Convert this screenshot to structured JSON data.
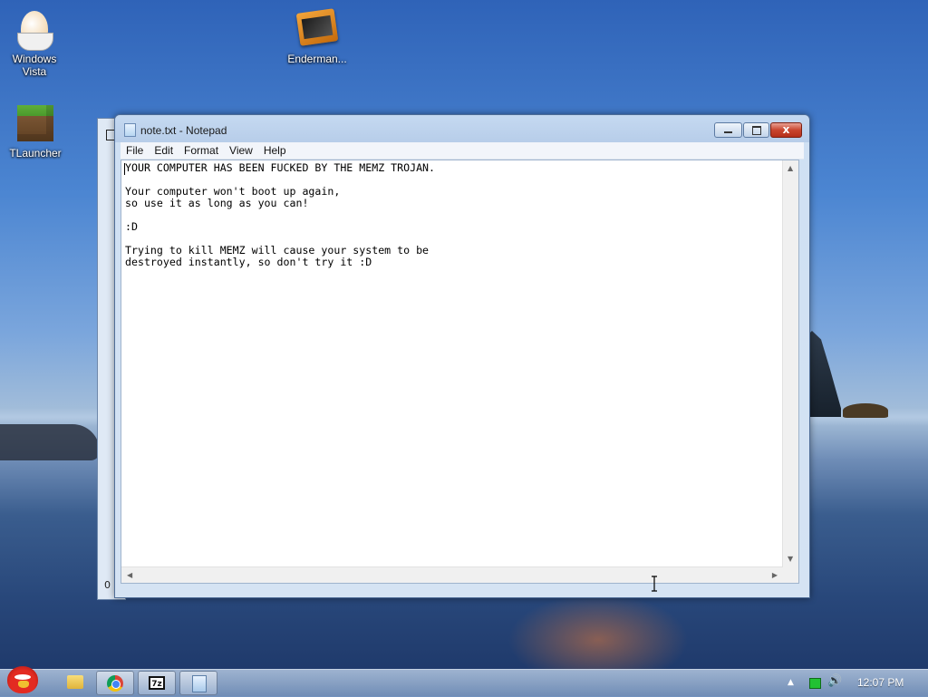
{
  "desktop": {
    "icons": [
      {
        "label": "Windows Vista"
      },
      {
        "label": "Enderman..."
      },
      {
        "label": "TLauncher"
      }
    ]
  },
  "background_window": {
    "status_digit": "0"
  },
  "notepad": {
    "title": "note.txt - Notepad",
    "menu": [
      "File",
      "Edit",
      "Format",
      "View",
      "Help"
    ],
    "content": "YOUR COMPUTER HAS BEEN FUCKED BY THE MEMZ TROJAN.\n\nYour computer won't boot up again,\nso use it as long as you can!\n\n:D\n\nTrying to kill MEMZ will cause your system to be\ndestroyed instantly, so don't try it :D",
    "close_glyph": "x"
  },
  "taskbar": {
    "sevenzip_label": "7z",
    "clock": "12:07 PM"
  },
  "colors": {
    "titlebar": "#c5d9f1",
    "close_button": "#c9452e",
    "taskbar": "#8aa6c8"
  }
}
